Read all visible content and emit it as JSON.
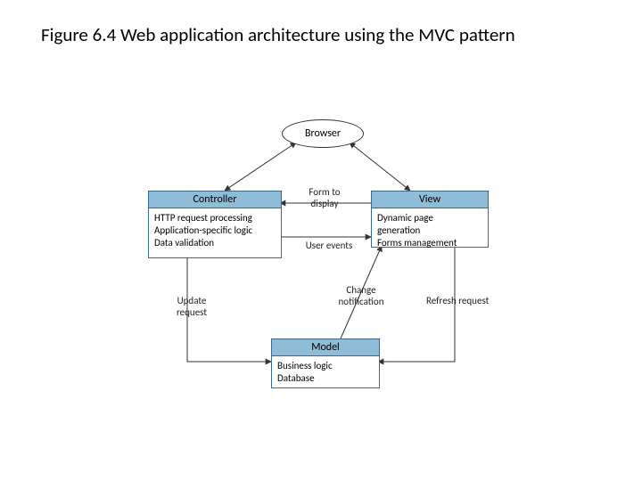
{
  "caption": "Figure 6.4 Web application architecture using the MVC pattern",
  "nodes": {
    "browser": {
      "label": "Browser"
    },
    "controller": {
      "title": "Controller",
      "body1": "HTTP request processing",
      "body2": "Application-specific logic",
      "body3": "Data validation"
    },
    "view": {
      "title": "View",
      "body1": "Dynamic page",
      "body2": "generation",
      "body3": "Forms management"
    },
    "model": {
      "title": "Model",
      "body1": "Business logic",
      "body2": "Database"
    }
  },
  "edge_labels": {
    "form_to_display": {
      "l1": "Form to",
      "l2": "display"
    },
    "user_events": "User events",
    "update_request": {
      "l1": "Update",
      "l2": "request"
    },
    "change_notification": {
      "l1": "Change",
      "l2": "notification"
    },
    "refresh_request": "Refresh request"
  }
}
